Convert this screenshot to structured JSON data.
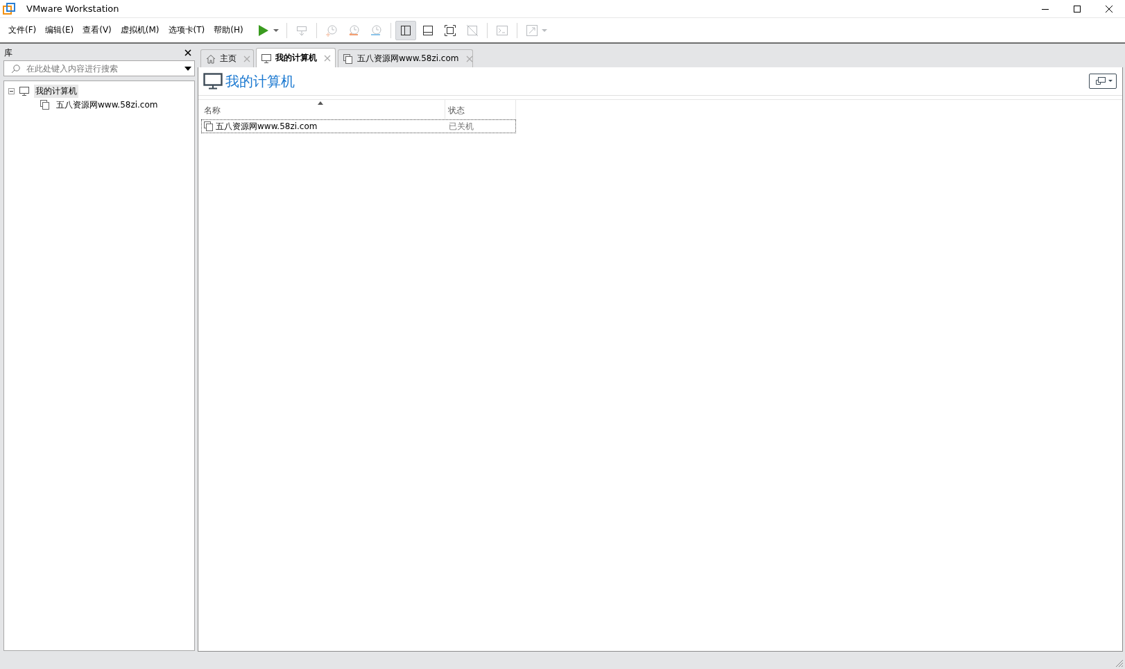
{
  "window": {
    "title": "VMware Workstation"
  },
  "menu": [
    "文件(F)",
    "编辑(E)",
    "查看(V)",
    "虚拟机(M)",
    "选项卡(T)",
    "帮助(H)"
  ],
  "toolbar": [
    {
      "kind": "play",
      "disabled": false,
      "selected": false
    },
    {
      "kind": "separator"
    },
    {
      "kind": "send-keys",
      "disabled": true,
      "selected": false
    },
    {
      "kind": "separator"
    },
    {
      "kind": "snapshot-take",
      "disabled": true,
      "selected": false
    },
    {
      "kind": "snapshot-revert",
      "disabled": true,
      "selected": false
    },
    {
      "kind": "snapshot-manage",
      "disabled": true,
      "selected": false
    },
    {
      "kind": "separator"
    },
    {
      "kind": "library-view",
      "disabled": false,
      "selected": true
    },
    {
      "kind": "thumbnail-view",
      "disabled": false,
      "selected": false
    },
    {
      "kind": "full-screen",
      "disabled": false,
      "selected": false
    },
    {
      "kind": "unity",
      "disabled": true,
      "selected": false
    },
    {
      "kind": "separator"
    },
    {
      "kind": "console",
      "disabled": true,
      "selected": false
    },
    {
      "kind": "separator"
    },
    {
      "kind": "stretch",
      "disabled": true,
      "selected": false
    }
  ],
  "library": {
    "title": "库",
    "search": {
      "placeholder": "在此处键入内容进行搜索"
    },
    "tree": [
      {
        "label": "我的计算机",
        "kind": "computer",
        "expanded": true,
        "selected": true,
        "children": [
          {
            "label": "五八资源网www.58zi.com",
            "kind": "vm",
            "selected": false
          }
        ]
      }
    ]
  },
  "tabs": [
    {
      "label": "主页",
      "kind": "home",
      "selected": false
    },
    {
      "label": "我的计算机",
      "kind": "computer",
      "selected": true
    },
    {
      "label": "五八资源网www.58zi.com",
      "kind": "vm",
      "selected": false
    }
  ],
  "page": {
    "title": "我的计算机"
  },
  "table": {
    "columns": [
      {
        "label": "名称",
        "sorted": true
      },
      {
        "label": "状态",
        "sorted": false
      }
    ],
    "rows": [
      {
        "name": "五八资源网www.58zi.com",
        "status": "已关机",
        "selected": true
      }
    ]
  }
}
